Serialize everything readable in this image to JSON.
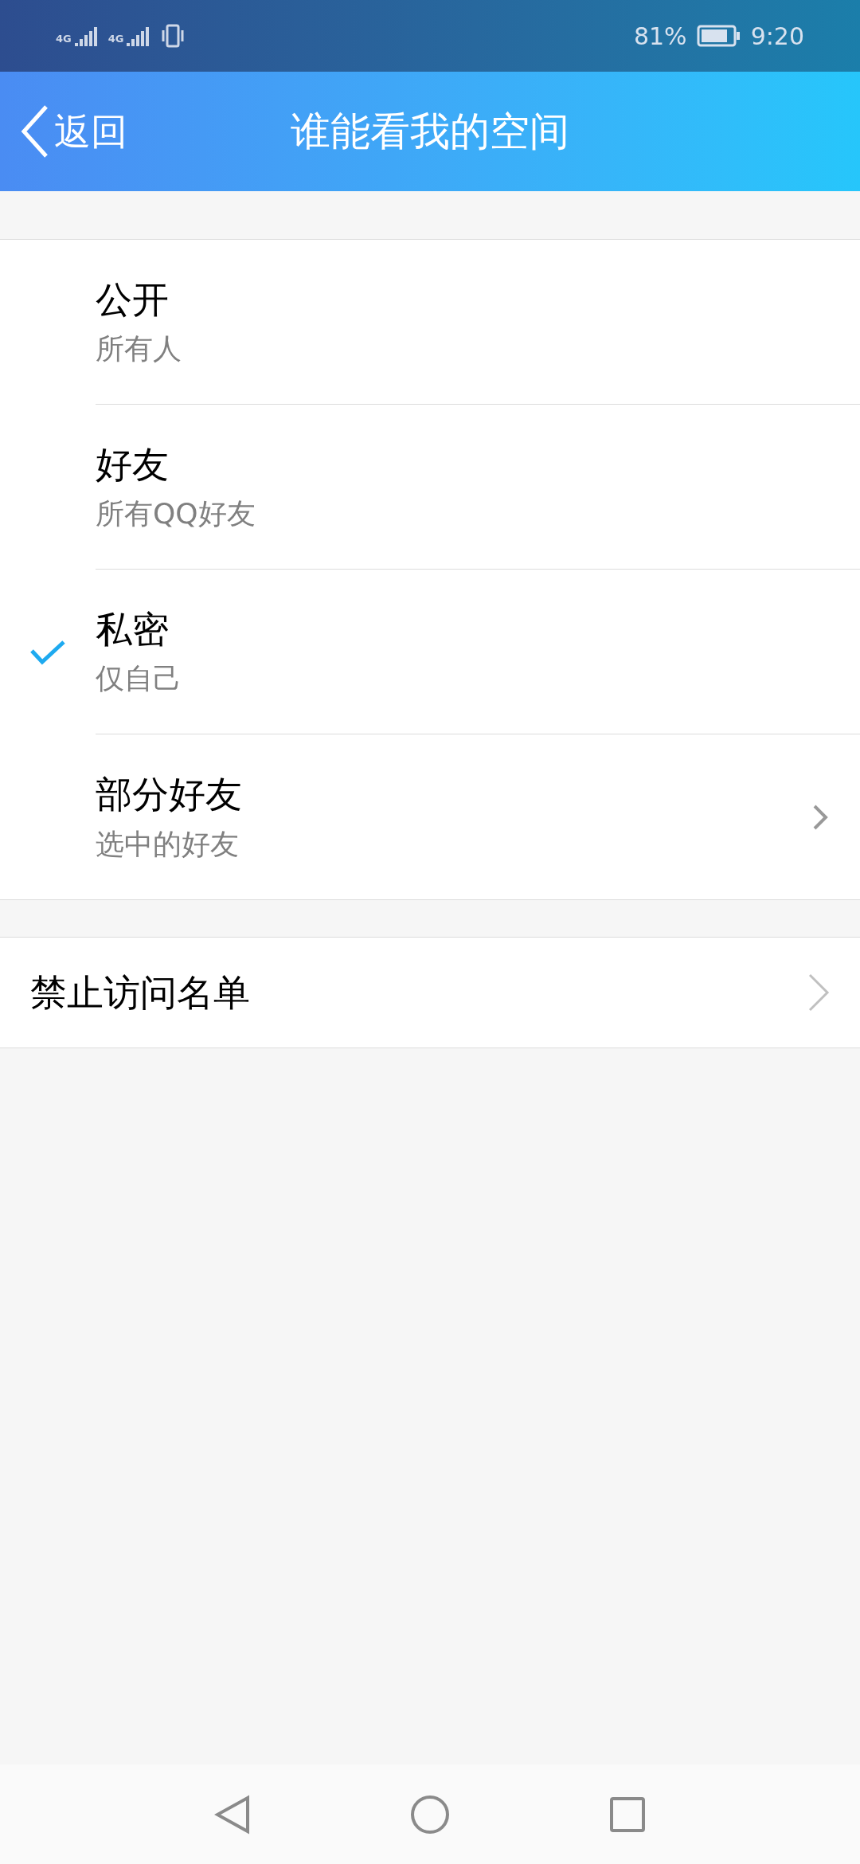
{
  "status_bar": {
    "networks": [
      "4G",
      "4G"
    ],
    "battery_percent": "81%",
    "time": "9:20"
  },
  "header": {
    "back_label": "返回",
    "title": "谁能看我的空间"
  },
  "options": [
    {
      "title": "公开",
      "subtitle": "所有人",
      "selected": false,
      "has_chevron": false
    },
    {
      "title": "好友",
      "subtitle": "所有QQ好友",
      "selected": false,
      "has_chevron": false
    },
    {
      "title": "私密",
      "subtitle": "仅自己",
      "selected": true,
      "has_chevron": false
    },
    {
      "title": "部分好友",
      "subtitle": "选中的好友",
      "selected": false,
      "has_chevron": true
    }
  ],
  "blocklist": {
    "label": "禁止访问名单"
  }
}
